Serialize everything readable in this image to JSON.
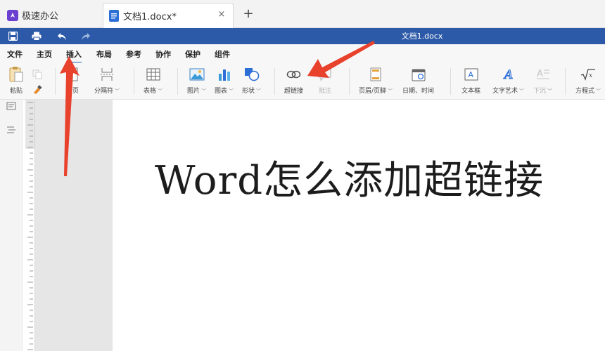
{
  "tabs": {
    "app_tab_label": "极速办公",
    "doc_tab_label": "文档1.docx*",
    "close_glyph": "×",
    "new_tab_glyph": "+"
  },
  "titlebar": {
    "title": "文档1.docx",
    "quick_access": [
      "save-icon",
      "print-icon",
      "undo-icon",
      "redo-icon"
    ]
  },
  "menu": {
    "items": [
      "文件",
      "主页",
      "插入",
      "布局",
      "参考",
      "协作",
      "保护",
      "组件"
    ],
    "active": "插入"
  },
  "ribbon": {
    "paste": "粘贴",
    "blank_page": "白页",
    "page_break": "分隔符",
    "table": "表格",
    "image": "图片",
    "chart": "图表",
    "shape": "形状",
    "hyperlink": "超链接",
    "comment": "批注",
    "header_footer": "页眉/页脚",
    "date_time": "日期、时间",
    "text_box": "文本框",
    "word_art": "文字艺术",
    "drop_cap": "下沉",
    "equation": "方程式"
  },
  "document": {
    "body_text": "Word怎么添加超链接"
  },
  "colors": {
    "title_bar": "#2c5aa8",
    "annotation_arrow": "#e8412c",
    "app_icon": "#6b3fd0",
    "doc_icon": "#2c6fd6"
  }
}
